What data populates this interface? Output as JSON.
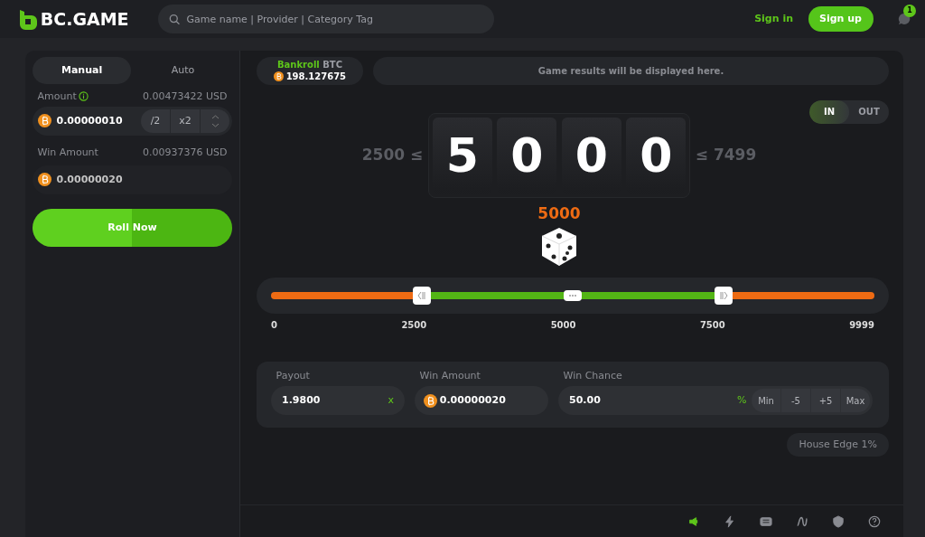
{
  "header": {
    "logo": "BC.GAME",
    "search": {
      "placeholder": "Game name | Provider | Category Tag"
    },
    "sign_in": "Sign in",
    "sign_up": "Sign up",
    "chat_badge": "1"
  },
  "bet_panel": {
    "tabs": [
      {
        "label": "Manual",
        "selected": true
      },
      {
        "label": "Auto",
        "selected": false
      }
    ],
    "amount": {
      "label": "Amount",
      "usd": "0.00473422 USD",
      "value": "0.00000010",
      "buttons": [
        "/2",
        "x2"
      ]
    },
    "win_amount": {
      "label": "Win Amount",
      "usd": "0.00937376 USD",
      "value": "0.00000020"
    },
    "roll_button": "Roll Now"
  },
  "game": {
    "bankroll": {
      "label": "Bankroll",
      "currency": "BTC",
      "value": "198.127675"
    },
    "results_message": "Game results will be displayed here.",
    "mode": [
      {
        "label": "IN",
        "selected": true
      },
      {
        "label": "OUT",
        "selected": false
      }
    ],
    "range_low": "2500 ≤",
    "digits": [
      "5",
      "0",
      "0",
      "0"
    ],
    "range_high": "≤ 7499",
    "result": "5000",
    "slider": {
      "low": {
        "level": 0.25
      },
      "high": {
        "level": 0.75
      },
      "labels": [
        "0",
        "2500",
        "5000",
        "7500",
        "9999"
      ]
    },
    "payout": {
      "label": "Payout",
      "value": "1.9800",
      "suffix": "x"
    },
    "win_amount": {
      "label": "Win Amount",
      "value": "0.00000020"
    },
    "win_chance": {
      "label": "Win Chance",
      "value": "50.00",
      "suffix": "%",
      "buttons": [
        "Min",
        "-5",
        "+5",
        "Max"
      ]
    },
    "house_edge": "House Edge 1%"
  },
  "toolbar": [
    {
      "kind": "sound",
      "selected": true
    },
    {
      "kind": "bolt",
      "selected": false
    },
    {
      "kind": "keyboard",
      "selected": false
    },
    {
      "kind": "chart",
      "selected": false
    },
    {
      "kind": "shield",
      "selected": false
    },
    {
      "kind": "help",
      "selected": false
    }
  ]
}
